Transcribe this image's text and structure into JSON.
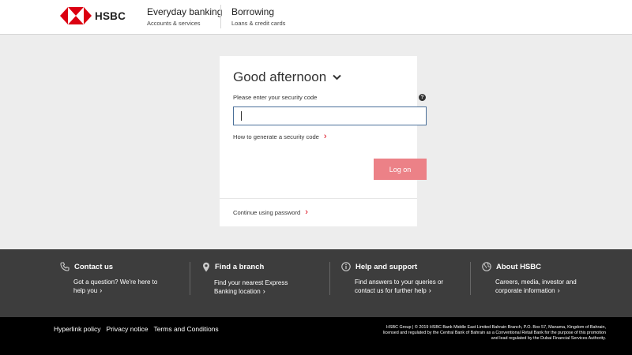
{
  "brand": {
    "name": "HSBC",
    "colors": {
      "red": "#db0011",
      "button": "#ec8187",
      "footer": "#3d3d3d"
    }
  },
  "nav": [
    {
      "title": "Everyday banking",
      "sub": "Accounts & services"
    },
    {
      "title": "Borrowing",
      "sub": "Loans & credit cards"
    }
  ],
  "login": {
    "greeting": "Good afternoon",
    "code_label": "Please enter your security code",
    "help_icon": "?",
    "input_value": "",
    "how_link": "How to generate a security code",
    "logon_label": "Log on",
    "continue_link": "Continue using password"
  },
  "footer": [
    {
      "icon": "phone-icon",
      "title": "Contact us",
      "line1": "Got a question? We're here to",
      "line2": "help you"
    },
    {
      "icon": "location-pin-icon",
      "title": "Find a branch",
      "line1": "Find your nearest Express",
      "line2": "Banking location"
    },
    {
      "icon": "info-icon",
      "title": "Help and support",
      "line1": "Find answers to your queries or",
      "line2": "contact us for further help"
    },
    {
      "icon": "globe-icon",
      "title": "About HSBC",
      "line1": "Careers, media, investor and",
      "line2": "corporate information"
    }
  ],
  "bottom": {
    "links": [
      "Hyperlink policy",
      "Privacy notice",
      "Terms and Conditions"
    ],
    "legal": "HSBC Group | © 2019 HSBC Bank Middle East Limited Bahrain Branch, P.O. Box 57, Manama, Kingdom of Bahrain, licensed and regulated by the Central Bank of Bahrain as a Conventional Retail Bank for the purpose of this promotion and lead regulated by the Dubai Financial Services Authority."
  }
}
